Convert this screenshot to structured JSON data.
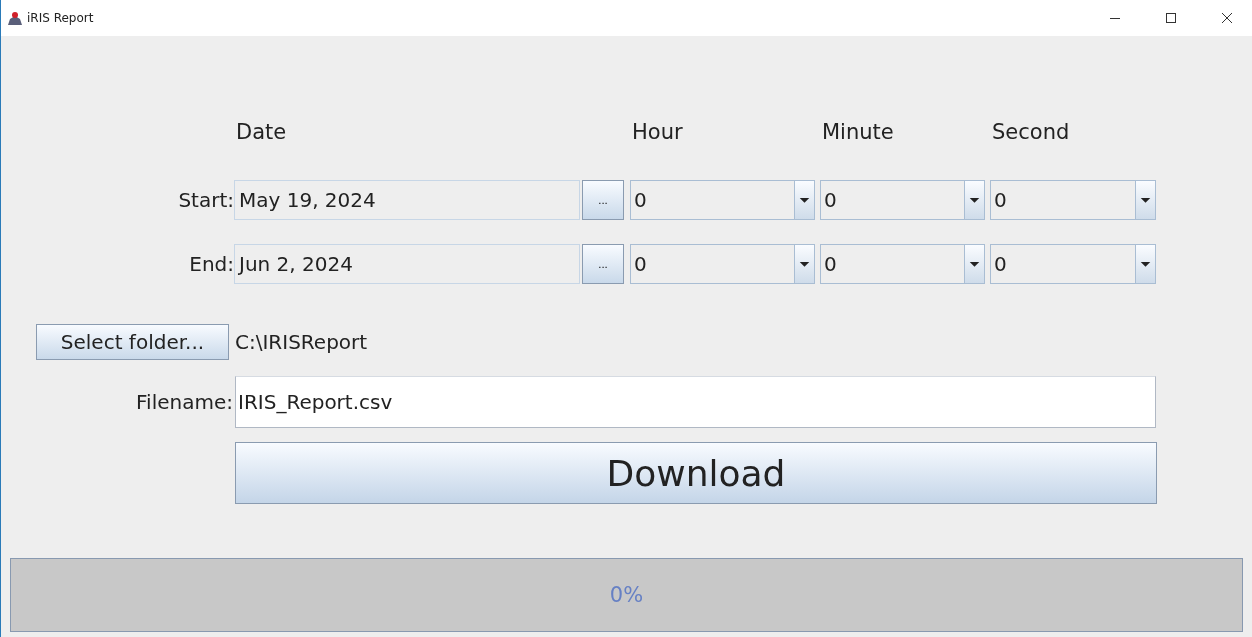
{
  "window": {
    "title": "iRIS Report"
  },
  "headers": [
    "Date",
    "Hour",
    "Minute",
    "Second"
  ],
  "rows": [
    {
      "label": "Start:",
      "date": "May 19, 2024",
      "picker": "...",
      "hour": "0",
      "minute": "0",
      "second": "0"
    },
    {
      "label": "End:",
      "date": "Jun 2, 2024",
      "picker": "...",
      "hour": "0",
      "minute": "0",
      "second": "0"
    }
  ],
  "folder": {
    "button": "Select folder...",
    "path": "C:\\IRISReport"
  },
  "filename": {
    "label": "Filename:",
    "value": "IRIS_Report.csv"
  },
  "download": "Download",
  "progress": {
    "level": 0,
    "reading": "0%"
  }
}
